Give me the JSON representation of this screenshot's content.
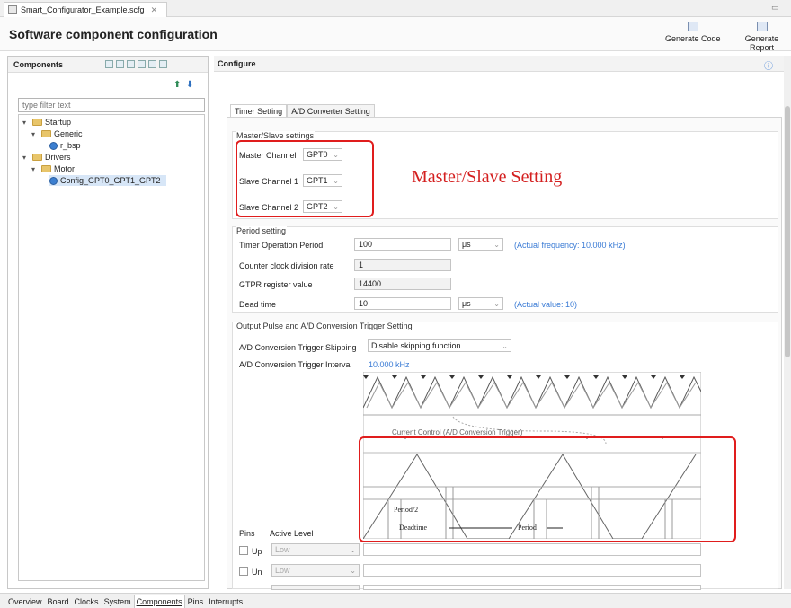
{
  "file_tab": {
    "label": "Smart_Configurator_Example.scfg",
    "close": "✕"
  },
  "header": {
    "title": "Software component configuration",
    "generate_code": "Generate Code",
    "generate_report": "Generate Report"
  },
  "components": {
    "title": "Components",
    "filter_placeholder": "type filter text",
    "tree": [
      {
        "label": "Startup",
        "kind": "folder",
        "level": 0,
        "expanded": true
      },
      {
        "label": "Generic",
        "kind": "folder",
        "level": 1,
        "expanded": true
      },
      {
        "label": "r_bsp",
        "kind": "component",
        "level": 2
      },
      {
        "label": "Drivers",
        "kind": "folder",
        "level": 0,
        "expanded": true
      },
      {
        "label": "Motor",
        "kind": "folder",
        "level": 1,
        "expanded": true
      },
      {
        "label": "Config_GPT0_GPT1_GPT2",
        "kind": "component",
        "level": 2,
        "selected": true
      }
    ]
  },
  "configure": {
    "title": "Configure",
    "info_icon": "ⓘ",
    "tabs": [
      "Timer Setting",
      "A/D Converter Setting"
    ],
    "master_slave": {
      "title": "Master/Slave settings",
      "master_label": "Master Channel",
      "master_value": "GPT0",
      "slave1_label": "Slave Channel 1",
      "slave1_value": "GPT1",
      "slave2_label": "Slave Channel 2",
      "slave2_value": "GPT2"
    },
    "period": {
      "title": "Period setting",
      "op_label": "Timer Operation Period",
      "op_value": "100",
      "op_unit": "μs",
      "op_note": "(Actual frequency: 10.000 kHz)",
      "div_label": "Counter clock division rate",
      "div_value": "1",
      "gtpr_label": "GTPR register value",
      "gtpr_value": "14400",
      "dead_label": "Dead time",
      "dead_value": "10",
      "dead_unit": "μs",
      "dead_note": "(Actual value: 10)"
    },
    "output": {
      "title": "Output Pulse and A/D Conversion Trigger Setting",
      "skip_label": "A/D Conversion Trigger Skipping",
      "skip_value": "Disable skipping function",
      "interval_label": "A/D Conversion Trigger Interval",
      "interval_value": "10.000 kHz",
      "current_control": "Current Control (A/D Conversion Trigger)",
      "period_half": "Period/2",
      "deadtime": "Deadtime",
      "period": "Period",
      "pins_label": "Pins",
      "active_level_label": "Active Level",
      "pins": [
        {
          "name": "Up",
          "level": "Low"
        },
        {
          "name": "Un",
          "level": "Low"
        }
      ]
    }
  },
  "annotation": {
    "text": "Master/Slave Setting",
    "color": "#e01d1d"
  },
  "bottom_tabs": [
    "Overview",
    "Board",
    "Clocks",
    "System",
    "Components",
    "Pins",
    "Interrupts"
  ],
  "active_bottom_tab": "Components"
}
